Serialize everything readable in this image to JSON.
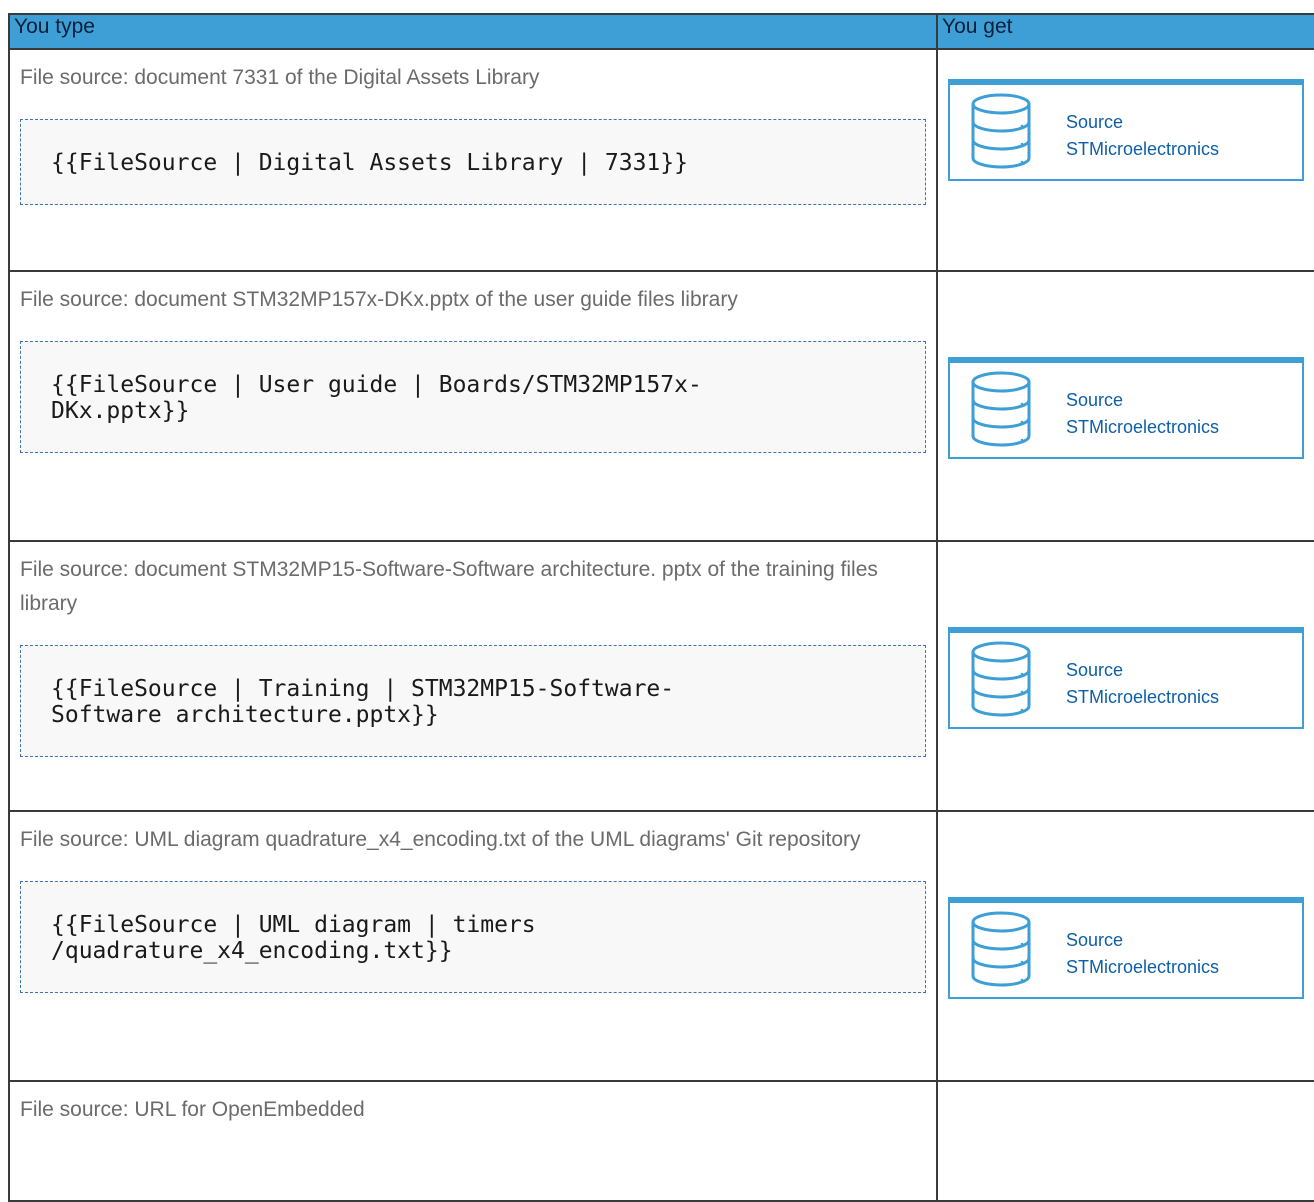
{
  "header": {
    "col_type": "You type",
    "col_get": "You get"
  },
  "rows": [
    {
      "description": "File source: document 7331 of the Digital Assets Library",
      "code": "{{FileSource | Digital Assets Library | 7331}}",
      "result": {
        "label": "Source",
        "owner": "STMicroelectronics"
      }
    },
    {
      "description": "File source: document STM32MP157x-DKx.pptx of the user guide files library",
      "code": "{{FileSource | User guide | Boards/STM32MP157x-\nDKx.pptx}}",
      "result": {
        "label": "Source",
        "owner": "STMicroelectronics"
      }
    },
    {
      "description": "File source: document STM32MP15-Software-Software architecture. pptx of the training files library",
      "code": "{{FileSource | Training | STM32MP15-Software-\nSoftware architecture.pptx}}",
      "result": {
        "label": "Source",
        "owner": "STMicroelectronics"
      }
    },
    {
      "description": "File source: UML diagram quadrature_x4_encoding.txt of the UML diagrams' Git repository",
      "code": "{{FileSource | UML diagram | timers\n/quadrature_x4_encoding.txt}}",
      "result": {
        "label": "Source",
        "owner": "STMicroelectronics"
      }
    },
    {
      "description": "File source: URL for OpenEmbedded"
    }
  ],
  "colors": {
    "header_bg": "#3e9fd6",
    "code_border": "#3f74b2",
    "source_text": "#0e5fa8"
  },
  "icons": {
    "source": "database-icon"
  }
}
